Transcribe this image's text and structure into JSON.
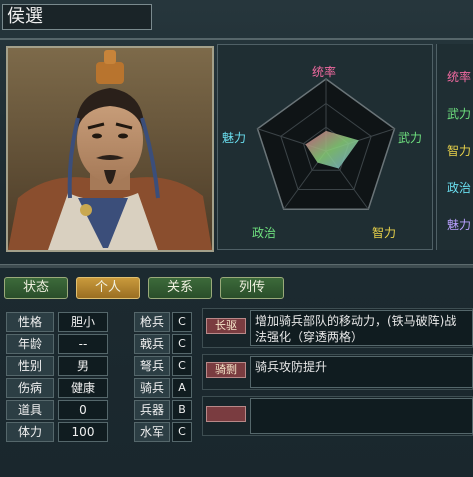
{
  "character": {
    "name": "侯選"
  },
  "radar": {
    "labels": {
      "command": "统率",
      "strength": "武力",
      "intelligence": "智力",
      "politics": "政治",
      "charm": "魅力"
    },
    "values": {
      "command": 0.28,
      "strength": 0.48,
      "intelligence": 0.3,
      "politics": 0.2,
      "charm": 0.3
    }
  },
  "stat_column": {
    "items": [
      {
        "label": "统率",
        "color": "#f06aa0"
      },
      {
        "label": "武力",
        "color": "#6ee07e"
      },
      {
        "label": "智力",
        "color": "#e8d24a"
      },
      {
        "label": "政治",
        "color": "#6adff0"
      },
      {
        "label": "魅力",
        "color": "#b9a0ff"
      }
    ]
  },
  "tabs": [
    "状态",
    "个人",
    "关系",
    "列传"
  ],
  "active_tab": "个人",
  "personal": [
    {
      "label": "性格",
      "value": "胆小"
    },
    {
      "label": "年龄",
      "value": "--"
    },
    {
      "label": "性别",
      "value": "男"
    },
    {
      "label": "伤病",
      "value": "健康"
    },
    {
      "label": "道具",
      "value": "0"
    },
    {
      "label": "体力",
      "value": "100"
    }
  ],
  "aptitude": [
    {
      "label": "枪兵",
      "grade": "C"
    },
    {
      "label": "戟兵",
      "grade": "C"
    },
    {
      "label": "弩兵",
      "grade": "C"
    },
    {
      "label": "骑兵",
      "grade": "A"
    },
    {
      "label": "兵器",
      "grade": "B"
    },
    {
      "label": "水军",
      "grade": "C"
    }
  ],
  "skills": [
    {
      "name": "长驱",
      "description": "增加骑兵部队的移动力，(铁马破阵)战法强化（穿透两格）"
    },
    {
      "name": "骑剽",
      "description": "骑兵攻防提升"
    },
    {
      "name": "",
      "description": ""
    }
  ],
  "colors": {
    "tab_active": "#c99a3c",
    "tab_inactive": "#3c6a3a",
    "skill_tag": "#7a3c40"
  }
}
